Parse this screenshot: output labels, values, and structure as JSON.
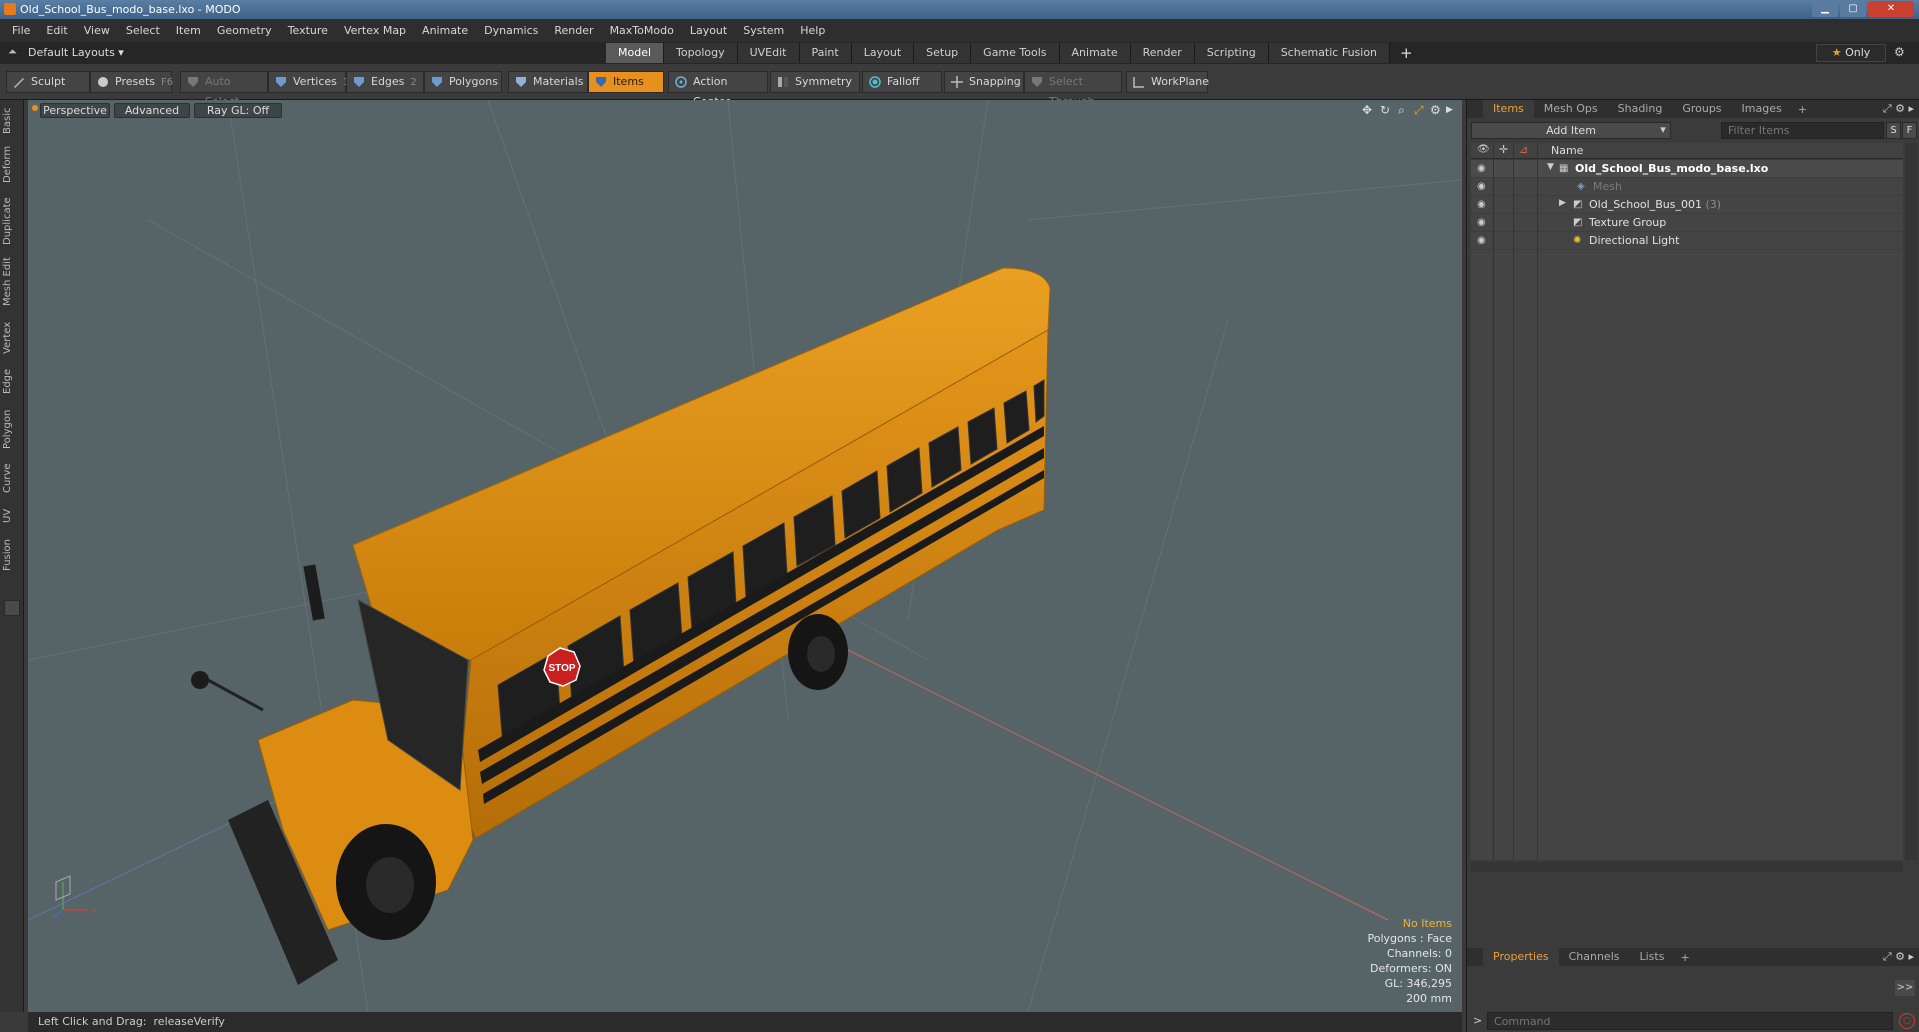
{
  "window": {
    "title": "Old_School_Bus_modo_base.lxo - MODO",
    "minimize": "▁",
    "maximize": "▢",
    "close": "✕"
  },
  "menu": [
    "File",
    "Edit",
    "View",
    "Select",
    "Item",
    "Geometry",
    "Texture",
    "Vertex Map",
    "Animate",
    "Dynamics",
    "Render",
    "MaxToModo",
    "Layout",
    "System",
    "Help"
  ],
  "layoutbar": {
    "layouts_label": "Default Layouts ▾",
    "tabs": [
      "Model",
      "Topology",
      "UVEdit",
      "Paint",
      "Layout",
      "Setup",
      "Game Tools",
      "Animate",
      "Render",
      "Scripting",
      "Schematic Fusion"
    ],
    "active_tab": "Model",
    "add_tab": "+",
    "only_label": "Only"
  },
  "toolbar": {
    "sculpt": "Sculpt",
    "presets": "Presets",
    "presets_key": "F6",
    "auto_select": "Auto Select",
    "vertices": "Vertices",
    "vertices_key": "1",
    "edges": "Edges",
    "edges_key": "2",
    "polygons": "Polygons",
    "materials": "Materials",
    "items": "Items",
    "action_center": "Action Center",
    "symmetry": "Symmetry",
    "falloff": "Falloff",
    "snapping": "Snapping",
    "select_through": "Select Through",
    "workplane": "WorkPlane"
  },
  "left_tabs": [
    "Basic",
    "Deform",
    "Duplicate",
    "Mesh Edit",
    "Vertex",
    "Edge",
    "Polygon",
    "Curve",
    "UV",
    "Fusion"
  ],
  "viewport": {
    "view": "Perspective",
    "shading": "Advanced",
    "raygl": "Ray GL: Off",
    "info": {
      "no_items": "No Items",
      "polygons": "Polygons : Face",
      "channels": "Channels: 0",
      "deformers": "Deformers: ON",
      "gl": "GL: 346,295",
      "scale": "200 mm"
    },
    "stop_sign": "STOP"
  },
  "status": {
    "label": "Left Click and Drag:",
    "value": "releaseVerify"
  },
  "items_panel": {
    "tabs": [
      "Items",
      "Mesh Ops",
      "Shading",
      "Groups",
      "Images"
    ],
    "active_tab": "Items",
    "add_tab": "+",
    "add_item": "Add Item",
    "filter_placeholder": "Filter Items",
    "s_btn": "S",
    "f_btn": "F",
    "col_name": "Name",
    "tree": [
      {
        "label": "Old_School_Bus_modo_base.lxo",
        "count": ""
      },
      {
        "label": "Mesh",
        "count": ""
      },
      {
        "label": "Old_School_Bus_001",
        "count": "(3)"
      },
      {
        "label": "Texture Group",
        "count": ""
      },
      {
        "label": "Directional Light",
        "count": ""
      }
    ]
  },
  "properties_panel": {
    "tabs": [
      "Properties",
      "Channels",
      "Lists"
    ],
    "active_tab": "Properties",
    "add_tab": "+",
    "expand": ">>",
    "command_placeholder": "Command"
  },
  "colors": {
    "accent": "#e8901e",
    "viewport_bg": "#566467",
    "bus_yellow": "#e0900f"
  }
}
